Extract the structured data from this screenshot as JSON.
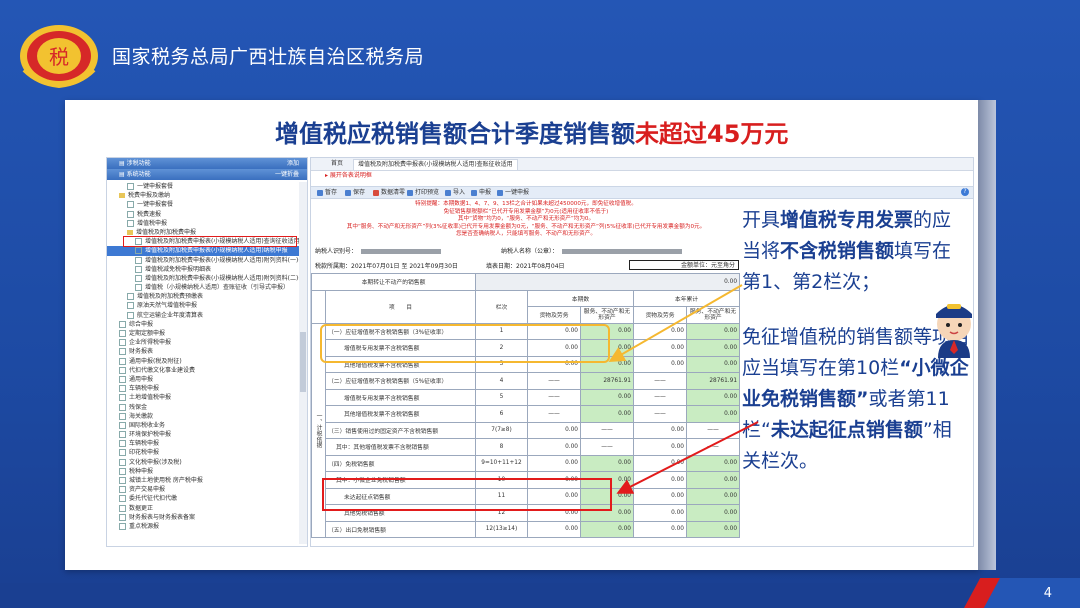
{
  "header": {
    "title": "国家税务总局广西壮族自治区税务局",
    "emblem_text": "税"
  },
  "slide": {
    "title_main": "增值税应税销售额合计季度销售额",
    "title_highlight": "未超过45万元",
    "page_number": "4"
  },
  "colors": {
    "brand_blue": "#1f4fa8",
    "accent_red": "#d81e1e",
    "highlight_orange": "#f5b830",
    "cell_green": "#c9ecc2"
  },
  "tree": {
    "bar1_left": "涉税功能",
    "bar1_right": "添加",
    "bar2_left": "系统功能",
    "bar2_right": "一键折叠",
    "items": [
      {
        "label": "一键申报套餐",
        "indent": 2,
        "type": "box"
      },
      {
        "label": "税费申报及缴纳",
        "indent": 1,
        "type": "fold"
      },
      {
        "label": "一键申报套餐",
        "indent": 2,
        "type": "box"
      },
      {
        "label": "税费速报",
        "indent": 2,
        "type": "box"
      },
      {
        "label": "增值税申报",
        "indent": 2,
        "type": "box"
      },
      {
        "label": "增值税及附加税费申报",
        "indent": 2,
        "type": "fold"
      },
      {
        "label": "增值税及附加税费申报表(小规模纳税人适用)查询征收适用",
        "indent": 3,
        "type": "box",
        "sel": false
      },
      {
        "label": "增值税及附加税费申报表(小规模纳税人适用)纳税申报",
        "indent": 3,
        "type": "box",
        "sel": true
      },
      {
        "label": "增值税及附加税费申报表(小规模纳税人适用)附列资料(一)(服务)",
        "indent": 3,
        "type": "box"
      },
      {
        "label": "增值税减免税申报明细表",
        "indent": 3,
        "type": "box"
      },
      {
        "label": "增值税及附加税费申报表(小规模纳税人适用)附列资料(二)(附加税费)",
        "indent": 3,
        "type": "box"
      },
      {
        "label": "增值税（小规模纳税人适用）查账征收（引导式申报）",
        "indent": 3,
        "type": "box"
      },
      {
        "label": "增值税及附加税费预缴表",
        "indent": 2,
        "type": "box"
      },
      {
        "label": "原油天然气增值税申报",
        "indent": 2,
        "type": "box"
      },
      {
        "label": "航空运输企业年度清算表",
        "indent": 2,
        "type": "box"
      },
      {
        "label": "综合申报",
        "indent": 1,
        "type": "box"
      },
      {
        "label": "定期定额申报",
        "indent": 1,
        "type": "box"
      },
      {
        "label": "企业所得税申报",
        "indent": 1,
        "type": "box"
      },
      {
        "label": "财务报表",
        "indent": 1,
        "type": "box"
      },
      {
        "label": "通用申报(税及附征)",
        "indent": 1,
        "type": "box"
      },
      {
        "label": "代扣代缴文化事业建设费",
        "indent": 1,
        "type": "box"
      },
      {
        "label": "通用申报",
        "indent": 1,
        "type": "box"
      },
      {
        "label": "车辆税申报",
        "indent": 1,
        "type": "box"
      },
      {
        "label": "土地增值税申报",
        "indent": 1,
        "type": "box"
      },
      {
        "label": "残保金",
        "indent": 1,
        "type": "box"
      },
      {
        "label": "海关缴款",
        "indent": 1,
        "type": "box"
      },
      {
        "label": "国际税收业务",
        "indent": 1,
        "type": "box"
      },
      {
        "label": "环境保护税申报",
        "indent": 1,
        "type": "box"
      },
      {
        "label": "车辆税申报",
        "indent": 1,
        "type": "box"
      },
      {
        "label": "印花税申报",
        "indent": 1,
        "type": "box"
      },
      {
        "label": "文化税申报(涉及税)",
        "indent": 1,
        "type": "box"
      },
      {
        "label": "税种申报",
        "indent": 1,
        "type": "box"
      },
      {
        "label": "城镇土地使用税 房产税申报",
        "indent": 1,
        "type": "box"
      },
      {
        "label": "资产交易申报",
        "indent": 1,
        "type": "box"
      },
      {
        "label": "委托代征代扣代缴",
        "indent": 1,
        "type": "box"
      },
      {
        "label": "数据更正",
        "indent": 1,
        "type": "box"
      },
      {
        "label": "财务报表与财务报表备案",
        "indent": 1,
        "type": "box"
      },
      {
        "label": "重点税源报",
        "indent": 1,
        "type": "box"
      }
    ]
  },
  "form": {
    "tabs": [
      "首页",
      "增值税及附加税费申报表(小规模纳税人适用)查账征收适用"
    ],
    "crumb": "▸ 展开各表说明框",
    "toolbar": [
      "暂存",
      "保存",
      "数据清零",
      "打印预览",
      "导入",
      "申报",
      "一键申报"
    ],
    "notice_lines": [
      "特别提醒：本期数据1、4、7、9、13栏之合计如果未超过450000元，即免征收增值税。",
      "免征销售额税额栏“已代开专用发票金额”为0元(适用征收率不低于)",
      "其中“货物”均为0，“服务、不动产和无形资产”均为0。",
      "其中“服务、不动产和无形资产”列(3%征收率)已代开专用发票金额为0元，“服务、不动产和无形资产”列(5%征收率)已代开专用发票金额为0元。",
      "您是否查确纳税人，只能填写服务、不动产和无形资产。"
    ],
    "taxpayer_id_label": "纳税人识别号：",
    "taxpayer_name_label": "纳税人名称（公章）：",
    "period_label": "税款所属期：2021年07月01日 至 2021年09月30日",
    "fill_date": "填表日期：2021年08月04日",
    "unit": "金额单位：元至角分",
    "sub_header_left": "本期转让不动产的销售额",
    "sub_header_value": "0.00",
    "col_item": "项　　目",
    "col_rownum": "栏次",
    "col_current": "本期数",
    "col_ytd": "本年累计",
    "col_goods": "货物及劳务",
    "col_services": "服务、不动产和无形资产",
    "vertical_label": "一、计税依据",
    "rows": [
      {
        "label": "（一）应征增值税不含税销售额（3%征收率）",
        "rownum": "1",
        "v1": "0.00",
        "v2": "0.00",
        "v3": "0.00",
        "v4": "0.00",
        "indent": 0
      },
      {
        "label": "增值税专用发票不含税销售额",
        "rownum": "2",
        "v1": "0.00",
        "v2": "0.00",
        "v3": "0.00",
        "v4": "0.00",
        "indent": 2
      },
      {
        "label": "其他增值税发票不含税销售额",
        "rownum": "3",
        "v1": "0.00",
        "v2": "0.00",
        "v3": "0.00",
        "v4": "0.00",
        "indent": 2
      },
      {
        "label": "（二）应征增值税不含税销售额（5%征收率）",
        "rownum": "4",
        "v1": "——",
        "v2": "28761.91",
        "v3": "——",
        "v4": "28761.91",
        "indent": 0
      },
      {
        "label": "增值税专用发票不含税销售额",
        "rownum": "5",
        "v1": "——",
        "v2": "0.00",
        "v3": "——",
        "v4": "0.00",
        "indent": 2
      },
      {
        "label": "其他增值税发票不含税销售额",
        "rownum": "6",
        "v1": "——",
        "v2": "0.00",
        "v3": "——",
        "v4": "0.00",
        "indent": 2
      },
      {
        "label": "（三）销售使用过的固定资产不含税销售额",
        "rownum": "7(7≥8)",
        "v1": "0.00",
        "v2": "——",
        "v3": "0.00",
        "v4": "——",
        "indent": 0
      },
      {
        "label": "其中：其他增值税发票不含税销售额",
        "rownum": "8",
        "v1": "0.00",
        "v2": "——",
        "v3": "0.00",
        "v4": "——",
        "indent": 1
      },
      {
        "label": "（四）免税销售额",
        "rownum": "9=10+11+12",
        "v1": "0.00",
        "v2": "0.00",
        "v3": "0.00",
        "v4": "0.00",
        "indent": 0
      },
      {
        "label": "其中：小微企业免税销售额",
        "rownum": "10",
        "v1": "0.00",
        "v2": "0.00",
        "v3": "0.00",
        "v4": "0.00",
        "indent": 1
      },
      {
        "label": "未达起征点销售额",
        "rownum": "11",
        "v1": "0.00",
        "v2": "0.00",
        "v3": "0.00",
        "v4": "0.00",
        "indent": 2
      },
      {
        "label": "其他免税销售额",
        "rownum": "12",
        "v1": "0.00",
        "v2": "0.00",
        "v3": "0.00",
        "v4": "0.00",
        "indent": 2
      },
      {
        "label": "（五）出口免税销售额",
        "rownum": "12(13≥14)",
        "v1": "0.00",
        "v2": "0.00",
        "v3": "0.00",
        "v4": "0.00",
        "indent": 0
      }
    ]
  },
  "tip": {
    "p1_a": "开具",
    "p1_b": "增值税专用发票",
    "p1_c": "的应当将",
    "p1_d": "不含税销售额",
    "p1_e": "填写在第1、第2栏次；",
    "p2_a": "免征增值税的销售额等项目应当填写在第10栏",
    "p2_b": "“小微企业免税销售额”",
    "p2_c": "或者第11栏“",
    "p2_d": "未达起征点销售额",
    "p2_e": "”相关栏次。"
  }
}
